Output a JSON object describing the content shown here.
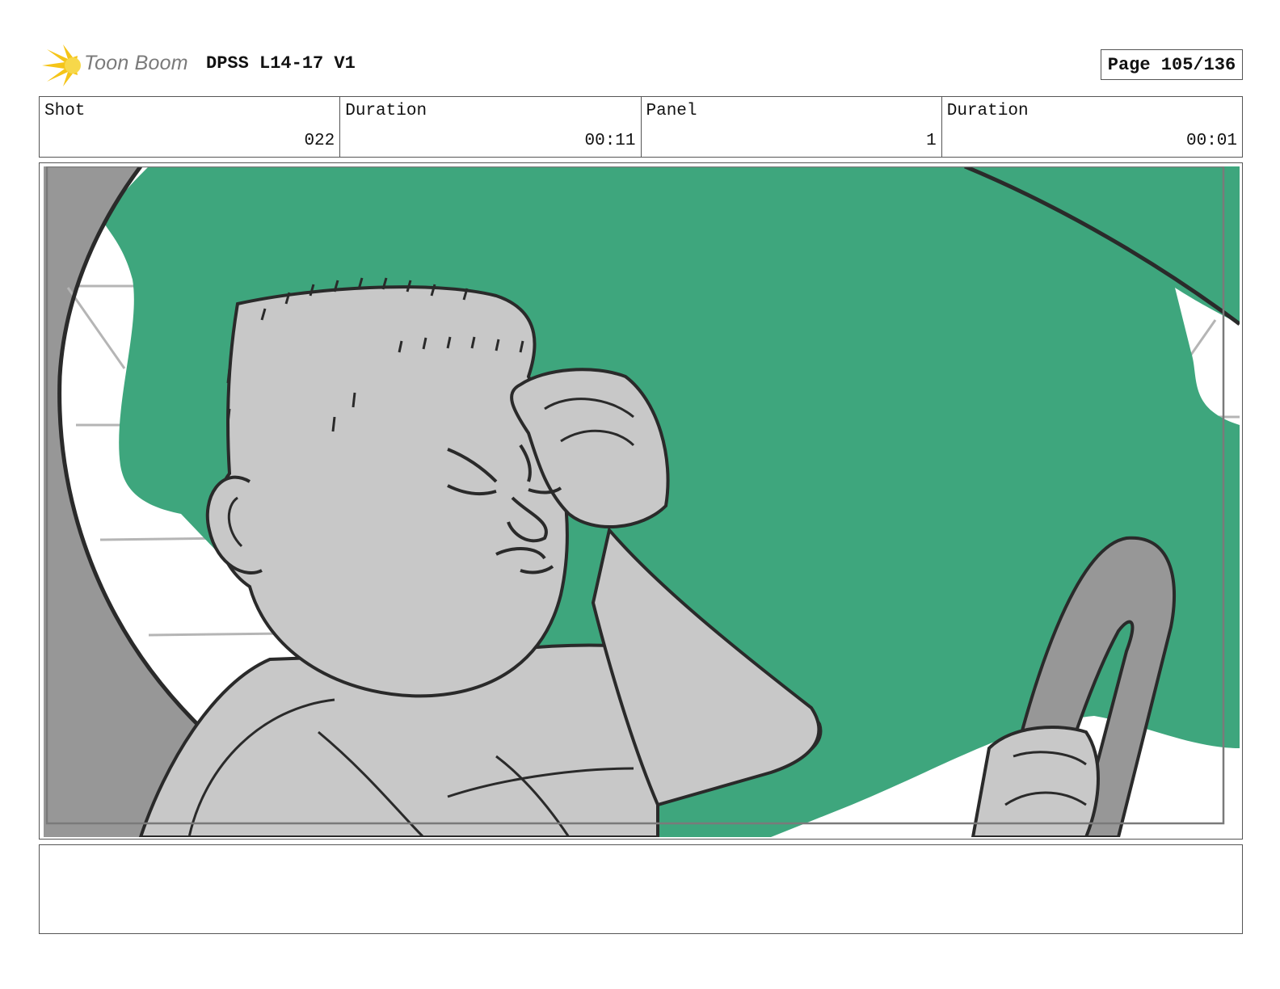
{
  "header": {
    "logo_text": "Toon Boom",
    "document_title": "DPSS L14-17 V1",
    "page_label": "Page 105/136"
  },
  "info": [
    {
      "label": "Shot",
      "value": "022"
    },
    {
      "label": "Duration",
      "value": "00:11"
    },
    {
      "label": "Panel",
      "value": "1"
    },
    {
      "label": "Duration",
      "value": "00:01"
    }
  ],
  "panel": {
    "colors": {
      "background_green": "#3ea67d",
      "figure_gray": "#c8c8c8",
      "dark_gray": "#979797",
      "line": "#2a2a2a",
      "logo_yellow": "#f5c518"
    }
  },
  "notes": {
    "text": ""
  }
}
